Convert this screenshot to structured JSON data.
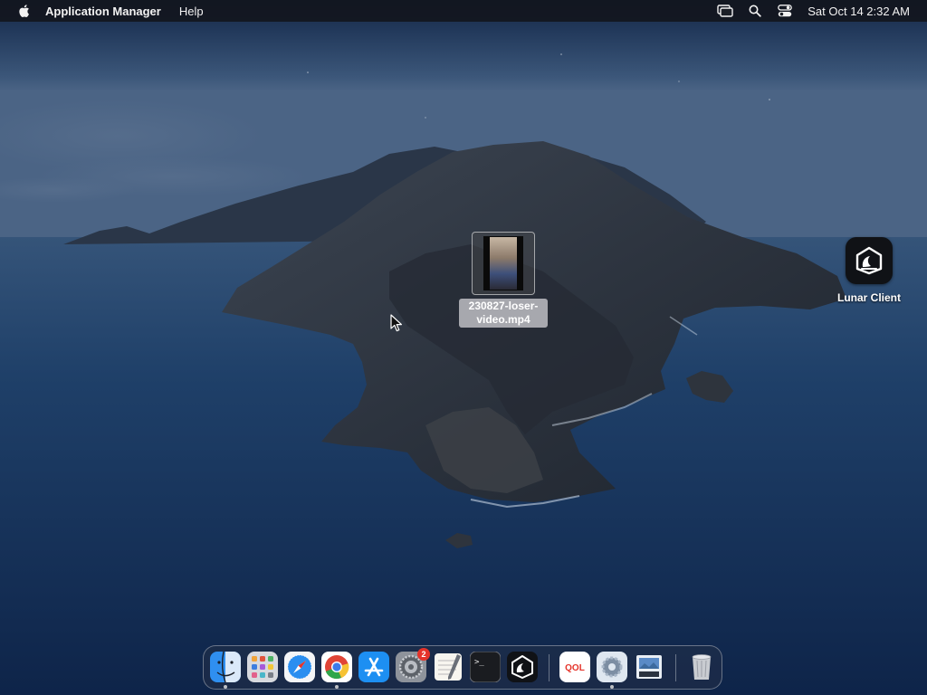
{
  "menubar": {
    "app_name": "Application Manager",
    "menus": [
      "Help"
    ],
    "clock": "Sat Oct 14  2:32 AM",
    "status_icons": [
      "screen-mirroring-icon",
      "spotlight-search-icon",
      "control-center-icon"
    ]
  },
  "desktop": {
    "file": {
      "label": "230827-loser-video.mp4",
      "icon": "video-thumbnail"
    },
    "app": {
      "label": "Lunar Client",
      "icon": "lunar-client-icon"
    }
  },
  "dock": {
    "apps": [
      {
        "name": "Finder",
        "icon": "finder-icon",
        "running": true
      },
      {
        "name": "Launchpad",
        "icon": "launchpad-icon",
        "running": false
      },
      {
        "name": "Safari",
        "icon": "safari-icon",
        "running": false
      },
      {
        "name": "Google Chrome",
        "icon": "chrome-icon",
        "running": true
      },
      {
        "name": "App Store",
        "icon": "app-store-icon",
        "running": false
      },
      {
        "name": "System Preferences",
        "icon": "system-preferences-icon",
        "running": false,
        "badge": "2"
      },
      {
        "name": "TextEdit",
        "icon": "textedit-icon",
        "running": false
      },
      {
        "name": "Terminal",
        "icon": "terminal-icon",
        "running": false
      },
      {
        "name": "Lunar Client",
        "icon": "lunar-client-icon",
        "running": false
      },
      {
        "name": "QOL",
        "icon": "qol-icon",
        "running": false
      },
      {
        "name": "Application Manager",
        "icon": "application-manager-icon",
        "running": true
      },
      {
        "name": "Preview",
        "icon": "preview-icon",
        "running": false
      },
      {
        "name": "Trash",
        "icon": "trash-icon",
        "running": false
      }
    ],
    "qol_text": "QOL",
    "terminal_prompt": ">_"
  },
  "colors": {
    "menubar_bg": "#12161e",
    "badge": "#e5332a",
    "sea": "#17325a"
  }
}
